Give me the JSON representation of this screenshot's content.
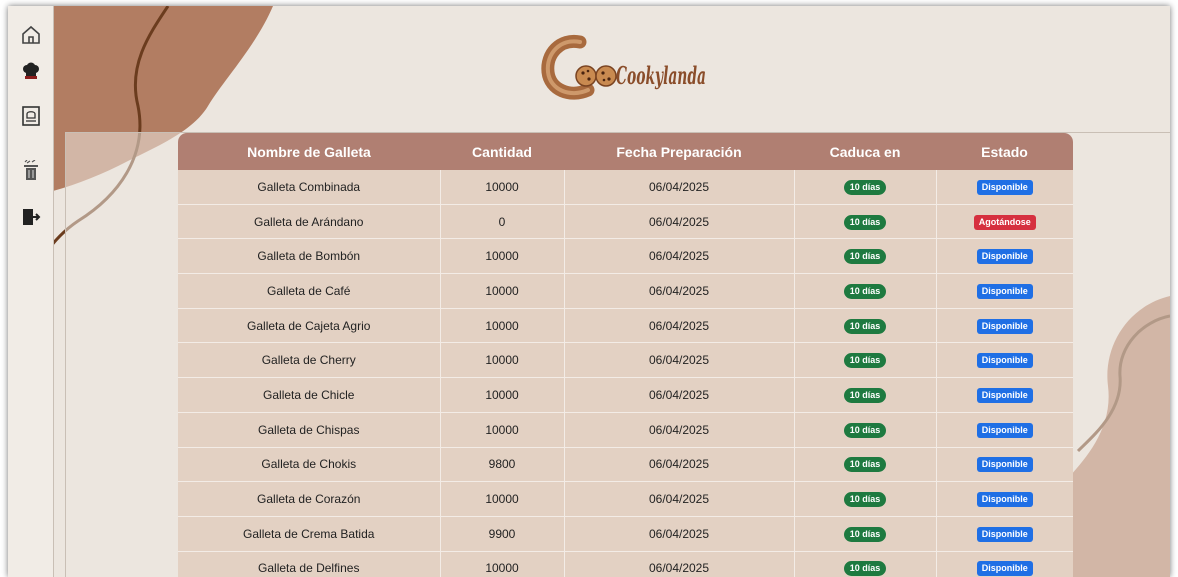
{
  "app": {
    "logo_text": "Cookylanda",
    "brand_color": "#b07f72",
    "background_color": "#ece6df"
  },
  "sidebar": {
    "items": [
      {
        "name": "home-icon"
      },
      {
        "name": "chef-hat-icon"
      },
      {
        "name": "recipe-book-icon"
      },
      {
        "name": "trash-icon"
      },
      {
        "name": "logout-icon"
      }
    ]
  },
  "table": {
    "headers": [
      "Nombre de Galleta",
      "Cantidad",
      "Fecha Preparación",
      "Caduca en",
      "Estado"
    ],
    "rows": [
      {
        "name": "Galleta Combinada",
        "qty": "10000",
        "date": "06/04/2025",
        "expires": "10 días",
        "status": "Disponible",
        "status_color": "#1f6fe5"
      },
      {
        "name": "Galleta de Arándano",
        "qty": "0",
        "date": "06/04/2025",
        "expires": "10 días",
        "status": "Agotándose",
        "status_color": "#d6303f"
      },
      {
        "name": "Galleta de Bombón",
        "qty": "10000",
        "date": "06/04/2025",
        "expires": "10 días",
        "status": "Disponible",
        "status_color": "#1f6fe5"
      },
      {
        "name": "Galleta de Café",
        "qty": "10000",
        "date": "06/04/2025",
        "expires": "10 días",
        "status": "Disponible",
        "status_color": "#1f6fe5"
      },
      {
        "name": "Galleta de Cajeta Agrio",
        "qty": "10000",
        "date": "06/04/2025",
        "expires": "10 días",
        "status": "Disponible",
        "status_color": "#1f6fe5"
      },
      {
        "name": "Galleta de Cherry",
        "qty": "10000",
        "date": "06/04/2025",
        "expires": "10 días",
        "status": "Disponible",
        "status_color": "#1f6fe5"
      },
      {
        "name": "Galleta de Chicle",
        "qty": "10000",
        "date": "06/04/2025",
        "expires": "10 días",
        "status": "Disponible",
        "status_color": "#1f6fe5"
      },
      {
        "name": "Galleta de Chispas",
        "qty": "10000",
        "date": "06/04/2025",
        "expires": "10 días",
        "status": "Disponible",
        "status_color": "#1f6fe5"
      },
      {
        "name": "Galleta de Chokis",
        "qty": "9800",
        "date": "06/04/2025",
        "expires": "10 días",
        "status": "Disponible",
        "status_color": "#1f6fe5"
      },
      {
        "name": "Galleta de Corazón",
        "qty": "10000",
        "date": "06/04/2025",
        "expires": "10 días",
        "status": "Disponible",
        "status_color": "#1f6fe5"
      },
      {
        "name": "Galleta de Crema Batida",
        "qty": "9900",
        "date": "06/04/2025",
        "expires": "10 días",
        "status": "Disponible",
        "status_color": "#1f6fe5"
      },
      {
        "name": "Galleta de Delfines",
        "qty": "10000",
        "date": "06/04/2025",
        "expires": "10 días",
        "status": "Disponible",
        "status_color": "#1f6fe5"
      }
    ]
  }
}
